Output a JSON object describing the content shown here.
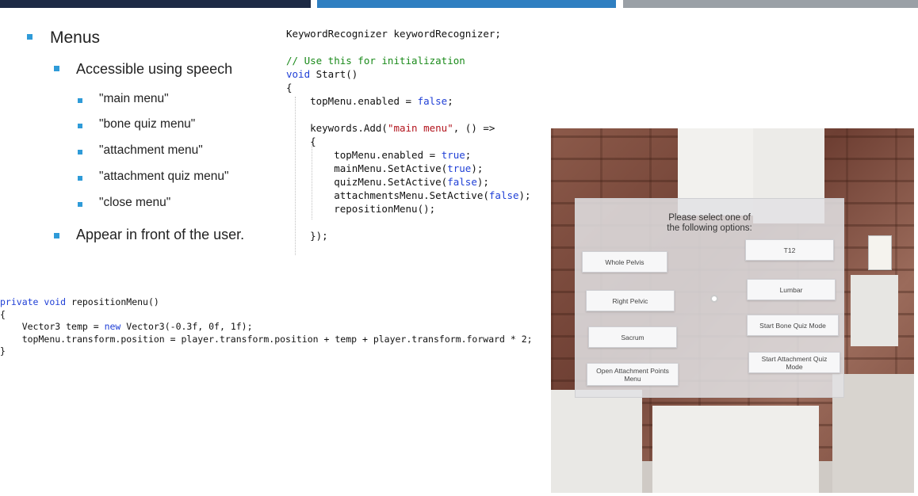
{
  "slide": {
    "bullets": {
      "menus": "Menus",
      "accessible": "Accessible using speech",
      "cmd_main": "\"main menu\"",
      "cmd_bone": "\"bone quiz menu\"",
      "cmd_attach": "\"attachment menu\"",
      "cmd_attach_quiz": "\"attachment quiz menu\"",
      "cmd_close": "\"close menu\"",
      "appear": "Appear in front of the user."
    }
  },
  "code_start": {
    "line1": "KeywordRecognizer keywordRecognizer;",
    "comment": "// Use this for initialization",
    "void_kw": "void",
    "start_sig": " Start()",
    "brace_open": "{",
    "top_menu_1": "topMenu.enabled = ",
    "false_kw": "false",
    "semicolon": ";",
    "keywords_add": "keywords.Add(",
    "main_menu_str": "\"main menu\"",
    "arrow": ", () =>",
    "top_menu_2": "topMenu.enabled = ",
    "true_kw": "true",
    "main_set": "mainMenu.SetActive(",
    "quiz_set": "quizMenu.SetActive(",
    "attach_set": "attachmentsMenu.SetActive(",
    "close_paren": ");",
    "reposition_call": "repositionMenu();",
    "close_block": "});"
  },
  "code_reposition": {
    "private_kw": "private",
    "void_kw": "void",
    "sig": " repositionMenu()",
    "brace_open": "{",
    "vec_decl": "Vector3 temp = ",
    "new_kw": "new",
    "vec_ctor": " Vector3(-0.3f, 0f, 1f);",
    "pos_line": "topMenu.transform.position = player.transform.position + temp + player.transform.forward * 2;",
    "brace_close": "}"
  },
  "holo_menu": {
    "prompt_line1": "Please select one of",
    "prompt_line2": "the following options:",
    "buttons": {
      "whole_pelvis": "Whole Pelvis",
      "t12": "T12",
      "right_pelvic": "Right Pelvic",
      "lumbar": "Lumbar",
      "sacrum": "Sacrum",
      "start_bone_quiz": "Start Bone Quiz Mode",
      "open_attachment": "Open Attachment Points Menu",
      "start_attachment_quiz": "Start Attachment Quiz Mode"
    }
  },
  "colors": {
    "bar_dark": "#1d2a45",
    "bar_blue": "#2f7fc1",
    "bar_gray": "#9aa0a6",
    "bullet": "#2f9bd8",
    "keyword": "#1f3fd6",
    "string": "#b3141d",
    "comment": "#1a8a1a"
  }
}
